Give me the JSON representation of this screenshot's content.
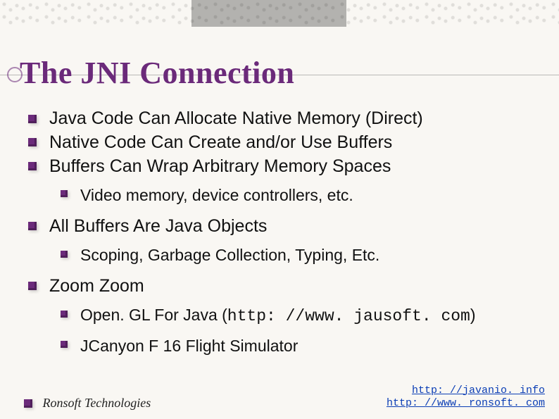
{
  "title": "The JNI Connection",
  "bullets": [
    {
      "text": "Java Code Can Allocate Native Memory (Direct)"
    },
    {
      "text": "Native Code Can Create and/or Use Buffers"
    },
    {
      "text": "Buffers Can Wrap Arbitrary Memory Spaces",
      "children": [
        {
          "text": "Video memory, device controllers, etc."
        }
      ]
    },
    {
      "text": "All Buffers Are Java Objects",
      "children": [
        {
          "text": "Scoping, Garbage Collection, Typing, Etc."
        }
      ]
    },
    {
      "text": "Zoom Zoom",
      "children": [
        {
          "prefix": "Open. GL For Java (",
          "code": "http: //www. jausoft. com",
          "suffix": ")"
        },
        {
          "text": "JCanyon F 16 Flight Simulator"
        }
      ]
    }
  ],
  "footer": {
    "left": "Ronsoft Technologies",
    "links": [
      "http: //javanio. info",
      "http: //www. ronsoft. com"
    ]
  }
}
